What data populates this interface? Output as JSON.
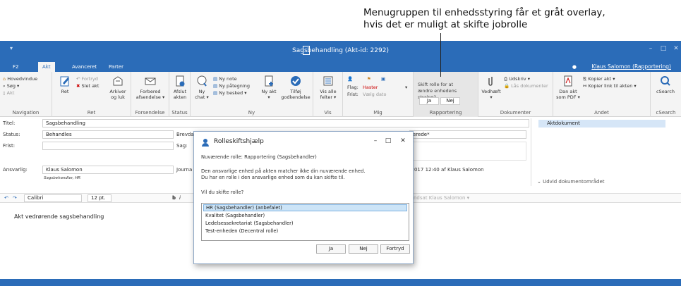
{
  "annotation": {
    "line1": "Menugruppen til enhedsstyring får et gråt overlay,",
    "line2": "hvis det er muligt at skifte jobrolle"
  },
  "window": {
    "title": "Sagsbehandling (Akt-id: 2292)",
    "qat": "▾",
    "min": "–",
    "max": "□",
    "close": "✕"
  },
  "tabs": [
    "F2",
    "Akt",
    "Avanceret",
    "Parter"
  ],
  "user": "Klaus Salomon (Rapportering)",
  "ribbon": {
    "nav": {
      "items": [
        "Hovedvindue",
        "Søg ▾",
        "Akt"
      ],
      "label": "Navigation"
    },
    "ret": {
      "ret": "Ret",
      "fortryd": "Fortryd",
      "slet": "Slet akt",
      "label": "Ret"
    },
    "fors": {
      "arkiver": "Arkiver og luk",
      "forbered": "Forbered afsendelse ▾",
      "label": "Forsendelse"
    },
    "status": {
      "afslut": "Afslut akten",
      "label": "Status"
    },
    "ny": {
      "chat": "Ny chat ▾",
      "note": "Ny note",
      "paategning": "Ny påtegning",
      "besked": "Ny besked ▾",
      "akt": "Ny akt ▾",
      "godk": "Tilføj godkendelse",
      "label": "Ny"
    },
    "vis": {
      "alle": "Vis alle felter ▾",
      "label": "Vis"
    },
    "mig": {
      "flag_label": "Flag:",
      "flag_value": "Haster",
      "frist_label": "Frist:",
      "frist_value": "Vælg dato",
      "label": "Mig"
    },
    "rap": {
      "question": "Skift rolle for at ændre enhedens styring?",
      "ja": "Ja",
      "nej": "Nej",
      "label": "Rapportering"
    },
    "dok": {
      "vedhaeft": "Vedhæft ▾",
      "udskriv": "Udskriv ▾",
      "laas": "Lås dokumenter",
      "label": "Dokumenter"
    },
    "andet": {
      "pdf": "Dan akt som PDF ▾",
      "kopier": "Kopier akt ▾",
      "kopierlink": "Kopier link til akten ▾",
      "label": "Andet"
    },
    "csearch": {
      "btn": "cSearch",
      "label": "cSearch"
    }
  },
  "form": {
    "titel_label": "Titel:",
    "titel_value": "Sagsbehandling",
    "status_label": "Status:",
    "status_value": "Behandles",
    "frist_label": "Frist:",
    "frist_value": "",
    "brevdato_label": "Brevda",
    "sag_label": "Sag:",
    "ansvarlig_label": "Ansvarlig:",
    "ansvarlig_value": "Klaus Salomon",
    "ansvarlig_sub": "Sagsbehandler, HR",
    "journal_label": "Journa",
    "right_field": "erede*",
    "date_line": "-2017 12:40   af   Klaus Salomon",
    "aktdok": "Aktdokument",
    "udvid": "Udvid dokumentområdet",
    "font": "Calibri",
    "size": "12 pt.",
    "sendt": "ndsat Klaus Salomon ▾",
    "body": "Akt vedrørende sagsbehandling"
  },
  "dialog": {
    "title": "Rolleskiftshjælp",
    "current": "Nuværende rolle: Rapportering (Sagsbehandler)",
    "msg1": "Den ansvarlige enhed på akten matcher ikke din nuværende enhed.",
    "msg2": "Du har en rolle i den ansvarlige enhed som du kan skifte til.",
    "question": "Vil du skifte rolle?",
    "options": [
      "HR (Sagsbehandler) (anbefalet)",
      "Kvalitet (Sagsbehandler)",
      "Ledelsessekretariat (Sagsbehandler)",
      "Test-enheden (Decentral rolle)"
    ],
    "ja": "Ja",
    "nej": "Nej",
    "fortryd": "Fortryd"
  }
}
